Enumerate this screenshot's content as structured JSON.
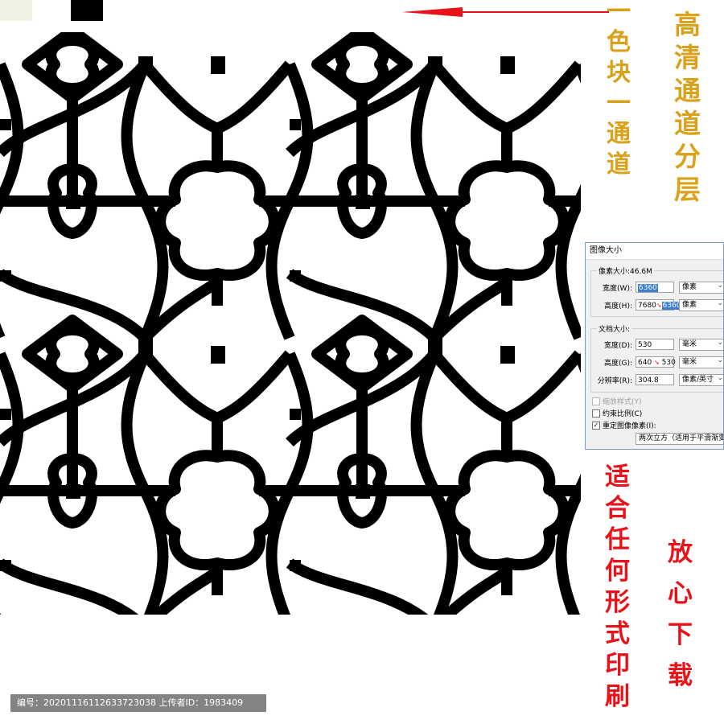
{
  "headings": {
    "gold_vertical": [
      "高",
      "清",
      "通",
      "道",
      "分",
      "层"
    ],
    "channel_vertical": [
      "一",
      "色",
      "块",
      "一",
      "通",
      "道"
    ],
    "print_vertical": [
      "适",
      "合",
      "任",
      "何",
      "形",
      "式",
      "印",
      "刷"
    ],
    "safe_vertical": [
      "放",
      "心",
      "下",
      "载"
    ]
  },
  "colors": {
    "gold": "#d9a21a",
    "red": "#e8121a",
    "pattern": "#000000",
    "swatch_green": "#eef3e4"
  },
  "dialog": {
    "title": "图像大小",
    "pixel_group": {
      "label": "像素大小:46.6M",
      "width_label": "宽度(W):",
      "width_value": "6360",
      "width_unit": "像素",
      "height_label": "高度(H):",
      "height_value_old": "7680",
      "height_value_new": "6360",
      "height_unit": "像素"
    },
    "doc_group": {
      "label": "文档大小:",
      "width_label": "宽度(D):",
      "width_value": "530",
      "width_unit": "毫米",
      "height_label": "高度(G):",
      "height_value_old": "640",
      "height_value_new": "530",
      "height_unit": "毫米",
      "resolution_label": "分辨率(R):",
      "resolution_value": "304.8",
      "resolution_unit": "像素/英寸"
    },
    "scale_styles": "缩放样式(Y)",
    "constrain": "约束比例(C)",
    "resample": "重定图像像素(I):",
    "resample_method": "两次立方（适用于平滑渐变"
  },
  "id_bar": "编号：20201116112633723038 上传者ID：1983409"
}
